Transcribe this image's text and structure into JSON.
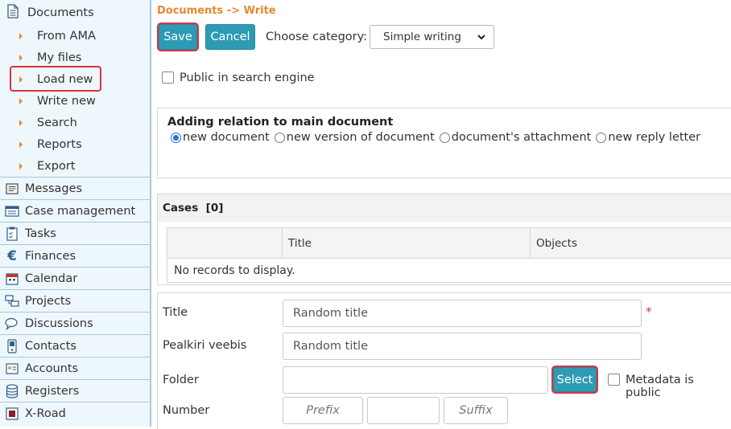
{
  "sidebar": {
    "documents_label": "Documents",
    "sub_items": [
      "From AMA",
      "My files",
      "Load new",
      "Write new",
      "Search",
      "Reports",
      "Export"
    ],
    "main_items": [
      {
        "label": "Messages",
        "icon": "messages-icon"
      },
      {
        "label": "Case management",
        "icon": "case-management-icon"
      },
      {
        "label": "Tasks",
        "icon": "tasks-icon"
      },
      {
        "label": "Finances",
        "icon": "euro-icon"
      },
      {
        "label": "Calendar",
        "icon": "calendar-icon"
      },
      {
        "label": "Projects",
        "icon": "projects-icon"
      },
      {
        "label": "Discussions",
        "icon": "discussions-icon"
      },
      {
        "label": "Contacts",
        "icon": "contacts-icon"
      },
      {
        "label": "Accounts",
        "icon": "accounts-icon"
      },
      {
        "label": "Registers",
        "icon": "registers-icon"
      },
      {
        "label": "X-Road",
        "icon": "x-road-icon"
      }
    ],
    "highlighted_item": "Load new"
  },
  "breadcrumb": "Documents -> Write",
  "toolbar": {
    "save_label": "Save",
    "cancel_label": "Cancel",
    "category_label": "Choose category:",
    "category_value": "Simple writing"
  },
  "public_search_label": "Public in search engine",
  "relation": {
    "title": "Adding relation to main document",
    "options": [
      "new document",
      "new version of document",
      "document's attachment",
      "new reply letter"
    ],
    "selected": "new document"
  },
  "cases": {
    "title": "Cases",
    "count": "[0]",
    "columns": [
      "",
      "Title",
      "Objects"
    ],
    "empty_text": "No records to display."
  },
  "form": {
    "title_label": "Title",
    "title_value": "Random title",
    "required_mark": "*",
    "web_title_label": "Pealkiri veebis",
    "web_title_value": "Random title",
    "folder_label": "Folder",
    "folder_value": "",
    "select_label": "Select",
    "metadata_public_label": "Metadata is public",
    "number_label": "Number",
    "prefix_placeholder": "Prefix",
    "number_value": "",
    "suffix_placeholder": "Suffix"
  },
  "colors": {
    "accent": "#2d9bb3",
    "breadcrumb": "#e8882e",
    "highlight": "#d9333f",
    "sidebar_bg": "#eef7fb"
  }
}
